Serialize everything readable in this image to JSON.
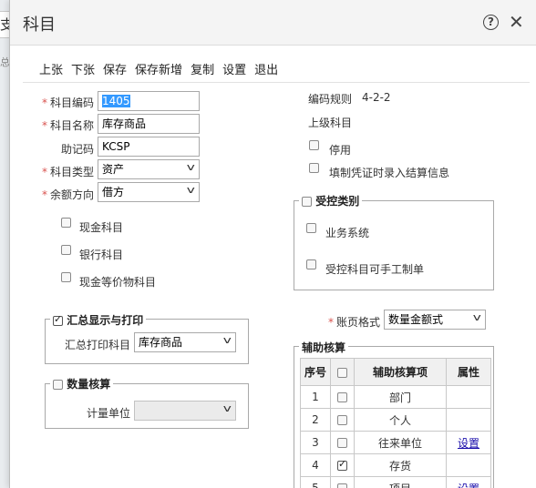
{
  "background": {
    "tab_label": "支",
    "second_label": "总账"
  },
  "dialog": {
    "title": "科目"
  },
  "toolbar": {
    "buttons": [
      "上张",
      "下张",
      "保存",
      "保存新增",
      "复制",
      "设置",
      "退出"
    ]
  },
  "form": {
    "code": {
      "label": "科目编码",
      "value": "1405"
    },
    "name": {
      "label": "科目名称",
      "value": "库存商品"
    },
    "mnemonic": {
      "label": "助记码",
      "value": "KCSP"
    },
    "type": {
      "label": "科目类型",
      "value": "资产"
    },
    "balance_dir": {
      "label": "余额方向",
      "value": "借方"
    },
    "cash_subject": "现金科目",
    "bank_subject": "银行科目",
    "cash_equiv": "现金等价物科目"
  },
  "right": {
    "code_rule_label": "编码规则",
    "code_rule_value": "4-2-2",
    "parent_label": "上级科目",
    "disabled_label": "停用",
    "settle_label": "填制凭证时录入结算信息"
  },
  "controlled": {
    "legend": "受控类别",
    "business_system": "业务系统",
    "manual_voucher": "受控科目可手工制单"
  },
  "summary": {
    "legend": "汇总显示与打印",
    "print_label": "汇总打印科目",
    "print_value": "库存商品"
  },
  "quantity": {
    "legend": "数量核算",
    "unit_label": "计量单位",
    "unit_value": ""
  },
  "ledger": {
    "label": "账页格式",
    "value": "数量金额式"
  },
  "aux": {
    "legend": "辅助核算",
    "headers": {
      "seq": "序号",
      "item": "辅助核算项",
      "attr": "属性"
    },
    "rows": [
      {
        "seq": "1",
        "item": "部门",
        "checked": false,
        "attr": ""
      },
      {
        "seq": "2",
        "item": "个人",
        "checked": false,
        "attr": ""
      },
      {
        "seq": "3",
        "item": "往来单位",
        "checked": false,
        "attr": "设置"
      },
      {
        "seq": "4",
        "item": "存货",
        "checked": true,
        "attr": ""
      },
      {
        "seq": "5",
        "item": "项目",
        "checked": false,
        "attr": "设置"
      }
    ]
  }
}
